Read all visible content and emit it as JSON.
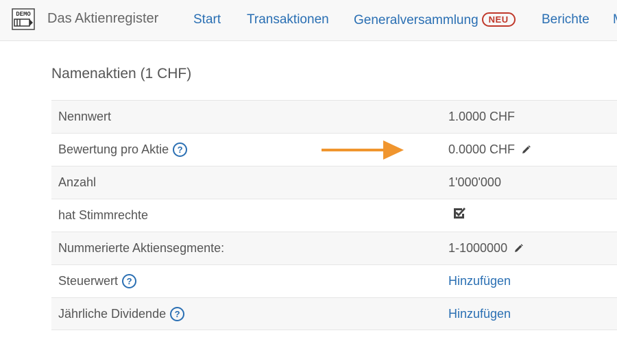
{
  "header": {
    "logo_text": "DEMO",
    "brand": "Das Aktienregister",
    "nav": {
      "start": "Start",
      "transaktionen": "Transaktionen",
      "generalversammlung": "Generalversammlung",
      "generalversammlung_badge": "NEU",
      "berichte": "Berichte",
      "cut_off": "M"
    }
  },
  "section": {
    "title": "Namenaktien (1 CHF)"
  },
  "rows": [
    {
      "label": "Nennwert",
      "value": "1.0000 CHF"
    },
    {
      "label": "Bewertung pro Aktie",
      "value": "0.0000 CHF",
      "help": "?"
    },
    {
      "label": "Anzahl",
      "value": "1'000'000"
    },
    {
      "label": "hat Stimmrechte",
      "value_icon": "checked-checkbox-icon",
      "value": true
    },
    {
      "label": "Nummerierte Aktiensegmente:",
      "value": "1-1000000"
    },
    {
      "label": "Steuerwert",
      "value": "Hinzufügen",
      "help": "?"
    },
    {
      "label": "Jährliche Dividende",
      "value": "Hinzufügen",
      "help": "?"
    }
  ],
  "icons": {
    "help": "question-circle-icon",
    "edit": "pencil-icon",
    "annotation": "arrow-right-icon"
  },
  "colors": {
    "link": "#2a6fb3",
    "badge": "#c0392b",
    "arrow": "#f0952e",
    "row_stripe": "#f7f7f7",
    "navbar": "#f8f8f8"
  }
}
